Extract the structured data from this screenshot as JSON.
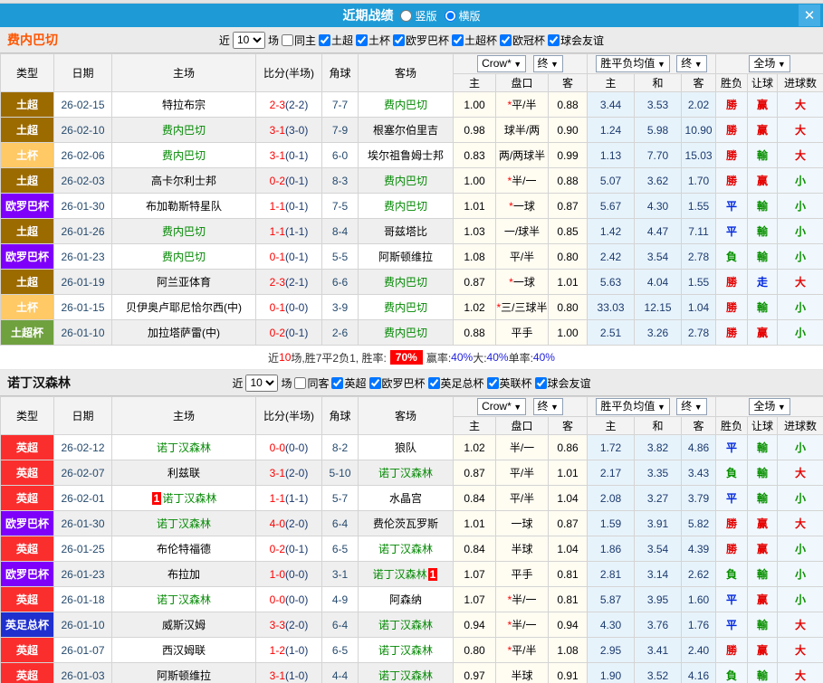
{
  "titlebar": {
    "title": "近期战绩",
    "vertical_label": "竖版",
    "horizontal_label": "横版",
    "close": "✕"
  },
  "dropdowns": {
    "crow": "Crow*",
    "final1": "终",
    "avg": "胜平负均值",
    "final2": "终",
    "full": "全场"
  },
  "columns": {
    "type": "类型",
    "date": "日期",
    "home": "主场",
    "score": "比分(半场)",
    "corners": "角球",
    "away": "客场",
    "odds_home": "主",
    "line": "盘口",
    "odds_away": "客",
    "avg_home": "主",
    "avg_draw": "和",
    "avg_away": "客",
    "result": "胜负",
    "handicap": "让球",
    "goals": "进球数"
  },
  "filter_labels": {
    "near": "近",
    "games": "场"
  },
  "league_colors": {
    "土超": "#9C6B00",
    "土杯": "#FFC966",
    "欧罗巴杯": "#7E00FA",
    "土超杯": "#70A13F",
    "英超": "#FB2E2E",
    "英足总杯": "#2030CF"
  },
  "colors": {
    "topbar": "#1E9BD7",
    "team1_name": "#FF5500",
    "team2_name": "#111111"
  },
  "teams": [
    {
      "name": "费内巴切",
      "name_color": "#FF5500",
      "filter": {
        "count": "10",
        "same_label": "同主",
        "leagues": [
          "土超",
          "土杯",
          "欧罗巴杯",
          "土超杯",
          "欧冠杯",
          "球会友谊"
        ]
      },
      "rows": [
        {
          "type": "土超",
          "date": "26-02-15",
          "home": "特拉布宗",
          "hteam": false,
          "hb": "",
          "score": "2-3",
          "half": "(2-2)",
          "corners": "7-7",
          "away": "费内巴切",
          "ateam": true,
          "ab": "",
          "o1": "1.00",
          "line_star": "*",
          "line": "平/半",
          "o2": "0.88",
          "a1": "3.44",
          "a2": "3.53",
          "a3": "2.02",
          "res": {
            "t": "勝",
            "c": "r"
          },
          "han": {
            "t": "赢",
            "c": "r"
          },
          "goal": {
            "t": "大",
            "c": "r"
          }
        },
        {
          "type": "土超",
          "date": "26-02-10",
          "home": "费内巴切",
          "hteam": true,
          "hb": "",
          "score": "3-1",
          "half": "(3-0)",
          "corners": "7-9",
          "away": "根塞尔伯里吉",
          "ateam": false,
          "ab": "",
          "o1": "0.98",
          "line_star": "",
          "line": "球半/两",
          "o2": "0.90",
          "a1": "1.24",
          "a2": "5.98",
          "a3": "10.90",
          "res": {
            "t": "勝",
            "c": "r"
          },
          "han": {
            "t": "赢",
            "c": "r"
          },
          "goal": {
            "t": "大",
            "c": "r"
          }
        },
        {
          "type": "土杯",
          "date": "26-02-06",
          "home": "费内巴切",
          "hteam": true,
          "hb": "",
          "score": "3-1",
          "half": "(0-1)",
          "corners": "6-0",
          "away": "埃尔祖鲁姆士邦",
          "ateam": false,
          "ab": "",
          "o1": "0.83",
          "line_star": "",
          "line": "两/两球半",
          "o2": "0.99",
          "a1": "1.13",
          "a2": "7.70",
          "a3": "15.03",
          "res": {
            "t": "勝",
            "c": "r"
          },
          "han": {
            "t": "輸",
            "c": "g"
          },
          "goal": {
            "t": "大",
            "c": "r"
          }
        },
        {
          "type": "土超",
          "date": "26-02-03",
          "home": "高卡尔利士邦",
          "hteam": false,
          "hb": "",
          "score": "0-2",
          "half": "(0-1)",
          "corners": "8-3",
          "away": "费内巴切",
          "ateam": true,
          "ab": "",
          "o1": "1.00",
          "line_star": "*",
          "line": "半/一",
          "o2": "0.88",
          "a1": "5.07",
          "a2": "3.62",
          "a3": "1.70",
          "res": {
            "t": "勝",
            "c": "r"
          },
          "han": {
            "t": "赢",
            "c": "r"
          },
          "goal": {
            "t": "小",
            "c": "g"
          }
        },
        {
          "type": "欧罗巴杯",
          "date": "26-01-30",
          "home": "布加勒斯特星队",
          "hteam": false,
          "hb": "",
          "score": "1-1",
          "half": "(0-1)",
          "corners": "7-5",
          "away": "费内巴切",
          "ateam": true,
          "ab": "",
          "o1": "1.01",
          "line_star": "*",
          "line": "一球",
          "o2": "0.87",
          "a1": "5.67",
          "a2": "4.30",
          "a3": "1.55",
          "res": {
            "t": "平",
            "c": "b"
          },
          "han": {
            "t": "輸",
            "c": "g"
          },
          "goal": {
            "t": "小",
            "c": "g"
          }
        },
        {
          "type": "土超",
          "date": "26-01-26",
          "home": "费内巴切",
          "hteam": true,
          "hb": "",
          "score": "1-1",
          "half": "(1-1)",
          "corners": "8-4",
          "away": "哥兹塔比",
          "ateam": false,
          "ab": "",
          "o1": "1.03",
          "line_star": "",
          "line": "一/球半",
          "o2": "0.85",
          "a1": "1.42",
          "a2": "4.47",
          "a3": "7.11",
          "res": {
            "t": "平",
            "c": "b"
          },
          "han": {
            "t": "輸",
            "c": "g"
          },
          "goal": {
            "t": "小",
            "c": "g"
          }
        },
        {
          "type": "欧罗巴杯",
          "date": "26-01-23",
          "home": "费内巴切",
          "hteam": true,
          "hb": "",
          "score": "0-1",
          "half": "(0-1)",
          "corners": "5-5",
          "away": "阿斯顿维拉",
          "ateam": false,
          "ab": "",
          "o1": "1.08",
          "line_star": "",
          "line": "平/半",
          "o2": "0.80",
          "a1": "2.42",
          "a2": "3.54",
          "a3": "2.78",
          "res": {
            "t": "負",
            "c": "g"
          },
          "han": {
            "t": "輸",
            "c": "g"
          },
          "goal": {
            "t": "小",
            "c": "g"
          }
        },
        {
          "type": "土超",
          "date": "26-01-19",
          "home": "阿兰亚体育",
          "hteam": false,
          "hb": "",
          "score": "2-3",
          "half": "(2-1)",
          "corners": "6-6",
          "away": "费内巴切",
          "ateam": true,
          "ab": "",
          "o1": "0.87",
          "line_star": "*",
          "line": "一球",
          "o2": "1.01",
          "a1": "5.63",
          "a2": "4.04",
          "a3": "1.55",
          "res": {
            "t": "勝",
            "c": "r"
          },
          "han": {
            "t": "走",
            "c": "b"
          },
          "goal": {
            "t": "大",
            "c": "r"
          }
        },
        {
          "type": "土杯",
          "date": "26-01-15",
          "home": "贝伊奥卢耶尼恰尔西(中)",
          "hteam": false,
          "hb": "",
          "score": "0-1",
          "half": "(0-0)",
          "corners": "3-9",
          "away": "费内巴切",
          "ateam": true,
          "ab": "",
          "o1": "1.02",
          "line_star": "*",
          "line": "三/三球半",
          "o2": "0.80",
          "a1": "33.03",
          "a2": "12.15",
          "a3": "1.04",
          "res": {
            "t": "勝",
            "c": "r"
          },
          "han": {
            "t": "輸",
            "c": "g"
          },
          "goal": {
            "t": "小",
            "c": "g"
          }
        },
        {
          "type": "土超杯",
          "date": "26-01-10",
          "home": "加拉塔萨雷(中)",
          "hteam": false,
          "hb": "",
          "score": "0-2",
          "half": "(0-1)",
          "corners": "2-6",
          "away": "费内巴切",
          "ateam": true,
          "ab": "",
          "o1": "0.88",
          "line_star": "",
          "line": "平手",
          "o2": "1.00",
          "a1": "2.51",
          "a2": "3.26",
          "a3": "2.78",
          "res": {
            "t": "勝",
            "c": "r"
          },
          "han": {
            "t": "赢",
            "c": "r"
          },
          "goal": {
            "t": "小",
            "c": "g"
          }
        }
      ],
      "summary": [
        {
          "t": "近",
          "c": "k"
        },
        {
          "t": "10",
          "c": "r"
        },
        {
          "t": "场,胜7平2负1, 胜率:",
          "c": "k"
        },
        {
          "t": "70%",
          "c": "hl"
        },
        {
          "t": "赢率:",
          "c": "k"
        },
        {
          "t": "40%",
          "c": "b"
        },
        {
          "t": " 大:",
          "c": "k"
        },
        {
          "t": "40%",
          "c": "b"
        },
        {
          "t": " 单率:",
          "c": "k"
        },
        {
          "t": "40%",
          "c": "b"
        }
      ]
    },
    {
      "name": "诺丁汉森林",
      "name_color": "#111111",
      "filter": {
        "count": "10",
        "same_label": "同客",
        "leagues": [
          "英超",
          "欧罗巴杯",
          "英足总杯",
          "英联杯",
          "球会友谊"
        ]
      },
      "rows": [
        {
          "type": "英超",
          "date": "26-02-12",
          "home": "诺丁汉森林",
          "hteam": true,
          "hb": "",
          "score": "0-0",
          "half": "(0-0)",
          "corners": "8-2",
          "away": "狼队",
          "ateam": false,
          "ab": "",
          "o1": "1.02",
          "line_star": "",
          "line": "半/一",
          "o2": "0.86",
          "a1": "1.72",
          "a2": "3.82",
          "a3": "4.86",
          "res": {
            "t": "平",
            "c": "b"
          },
          "han": {
            "t": "輸",
            "c": "g"
          },
          "goal": {
            "t": "小",
            "c": "g"
          }
        },
        {
          "type": "英超",
          "date": "26-02-07",
          "home": "利兹联",
          "hteam": false,
          "hb": "",
          "score": "3-1",
          "half": "(2-0)",
          "corners": "5-10",
          "away": "诺丁汉森林",
          "ateam": true,
          "ab": "",
          "o1": "0.87",
          "line_star": "",
          "line": "平/半",
          "o2": "1.01",
          "a1": "2.17",
          "a2": "3.35",
          "a3": "3.43",
          "res": {
            "t": "負",
            "c": "g"
          },
          "han": {
            "t": "輸",
            "c": "g"
          },
          "goal": {
            "t": "大",
            "c": "r"
          }
        },
        {
          "type": "英超",
          "date": "26-02-01",
          "home": "诺丁汉森林",
          "hteam": true,
          "hb": "1",
          "score": "1-1",
          "half": "(1-1)",
          "corners": "5-7",
          "away": "水晶宫",
          "ateam": false,
          "ab": "",
          "o1": "0.84",
          "line_star": "",
          "line": "平/半",
          "o2": "1.04",
          "a1": "2.08",
          "a2": "3.27",
          "a3": "3.79",
          "res": {
            "t": "平",
            "c": "b"
          },
          "han": {
            "t": "輸",
            "c": "g"
          },
          "goal": {
            "t": "小",
            "c": "g"
          }
        },
        {
          "type": "欧罗巴杯",
          "date": "26-01-30",
          "home": "诺丁汉森林",
          "hteam": true,
          "hb": "",
          "score": "4-0",
          "half": "(2-0)",
          "corners": "6-4",
          "away": "费伦茨瓦罗斯",
          "ateam": false,
          "ab": "",
          "o1": "1.01",
          "line_star": "",
          "line": "一球",
          "o2": "0.87",
          "a1": "1.59",
          "a2": "3.91",
          "a3": "5.82",
          "res": {
            "t": "勝",
            "c": "r"
          },
          "han": {
            "t": "赢",
            "c": "r"
          },
          "goal": {
            "t": "大",
            "c": "r"
          }
        },
        {
          "type": "英超",
          "date": "26-01-25",
          "home": "布伦特福德",
          "hteam": false,
          "hb": "",
          "score": "0-2",
          "half": "(0-1)",
          "corners": "6-5",
          "away": "诺丁汉森林",
          "ateam": true,
          "ab": "",
          "o1": "0.84",
          "line_star": "",
          "line": "半球",
          "o2": "1.04",
          "a1": "1.86",
          "a2": "3.54",
          "a3": "4.39",
          "res": {
            "t": "勝",
            "c": "r"
          },
          "han": {
            "t": "赢",
            "c": "r"
          },
          "goal": {
            "t": "小",
            "c": "g"
          }
        },
        {
          "type": "欧罗巴杯",
          "date": "26-01-23",
          "home": "布拉加",
          "hteam": false,
          "hb": "",
          "score": "1-0",
          "half": "(0-0)",
          "corners": "3-1",
          "away": "诺丁汉森林",
          "ateam": true,
          "ab": "1",
          "o1": "1.07",
          "line_star": "",
          "line": "平手",
          "o2": "0.81",
          "a1": "2.81",
          "a2": "3.14",
          "a3": "2.62",
          "res": {
            "t": "負",
            "c": "g"
          },
          "han": {
            "t": "輸",
            "c": "g"
          },
          "goal": {
            "t": "小",
            "c": "g"
          }
        },
        {
          "type": "英超",
          "date": "26-01-18",
          "home": "诺丁汉森林",
          "hteam": true,
          "hb": "",
          "score": "0-0",
          "half": "(0-0)",
          "corners": "4-9",
          "away": "阿森纳",
          "ateam": false,
          "ab": "",
          "o1": "1.07",
          "line_star": "*",
          "line": "半/一",
          "o2": "0.81",
          "a1": "5.87",
          "a2": "3.95",
          "a3": "1.60",
          "res": {
            "t": "平",
            "c": "b"
          },
          "han": {
            "t": "赢",
            "c": "r"
          },
          "goal": {
            "t": "小",
            "c": "g"
          }
        },
        {
          "type": "英足总杯",
          "date": "26-01-10",
          "home": "威斯汉姆",
          "hteam": false,
          "hb": "",
          "score": "3-3",
          "half": "(2-0)",
          "corners": "6-4",
          "away": "诺丁汉森林",
          "ateam": true,
          "ab": "",
          "o1": "0.94",
          "line_star": "*",
          "line": "半/一",
          "o2": "0.94",
          "a1": "4.30",
          "a2": "3.76",
          "a3": "1.76",
          "res": {
            "t": "平",
            "c": "b"
          },
          "han": {
            "t": "輸",
            "c": "g"
          },
          "goal": {
            "t": "大",
            "c": "r"
          }
        },
        {
          "type": "英超",
          "date": "26-01-07",
          "home": "西汉姆联",
          "hteam": false,
          "hb": "",
          "score": "1-2",
          "half": "(1-0)",
          "corners": "6-5",
          "away": "诺丁汉森林",
          "ateam": true,
          "ab": "",
          "o1": "0.80",
          "line_star": "*",
          "line": "平/半",
          "o2": "1.08",
          "a1": "2.95",
          "a2": "3.41",
          "a3": "2.40",
          "res": {
            "t": "勝",
            "c": "r"
          },
          "han": {
            "t": "赢",
            "c": "r"
          },
          "goal": {
            "t": "大",
            "c": "r"
          }
        },
        {
          "type": "英超",
          "date": "26-01-03",
          "home": "阿斯顿维拉",
          "hteam": false,
          "hb": "",
          "score": "3-1",
          "half": "(1-0)",
          "corners": "4-4",
          "away": "诺丁汉森林",
          "ateam": true,
          "ab": "",
          "o1": "0.97",
          "line_star": "",
          "line": "半球",
          "o2": "0.91",
          "a1": "1.90",
          "a2": "3.52",
          "a3": "4.16",
          "res": {
            "t": "負",
            "c": "g"
          },
          "han": {
            "t": "輸",
            "c": "g"
          },
          "goal": {
            "t": "大",
            "c": "r"
          }
        }
      ],
      "summary": null
    }
  ]
}
